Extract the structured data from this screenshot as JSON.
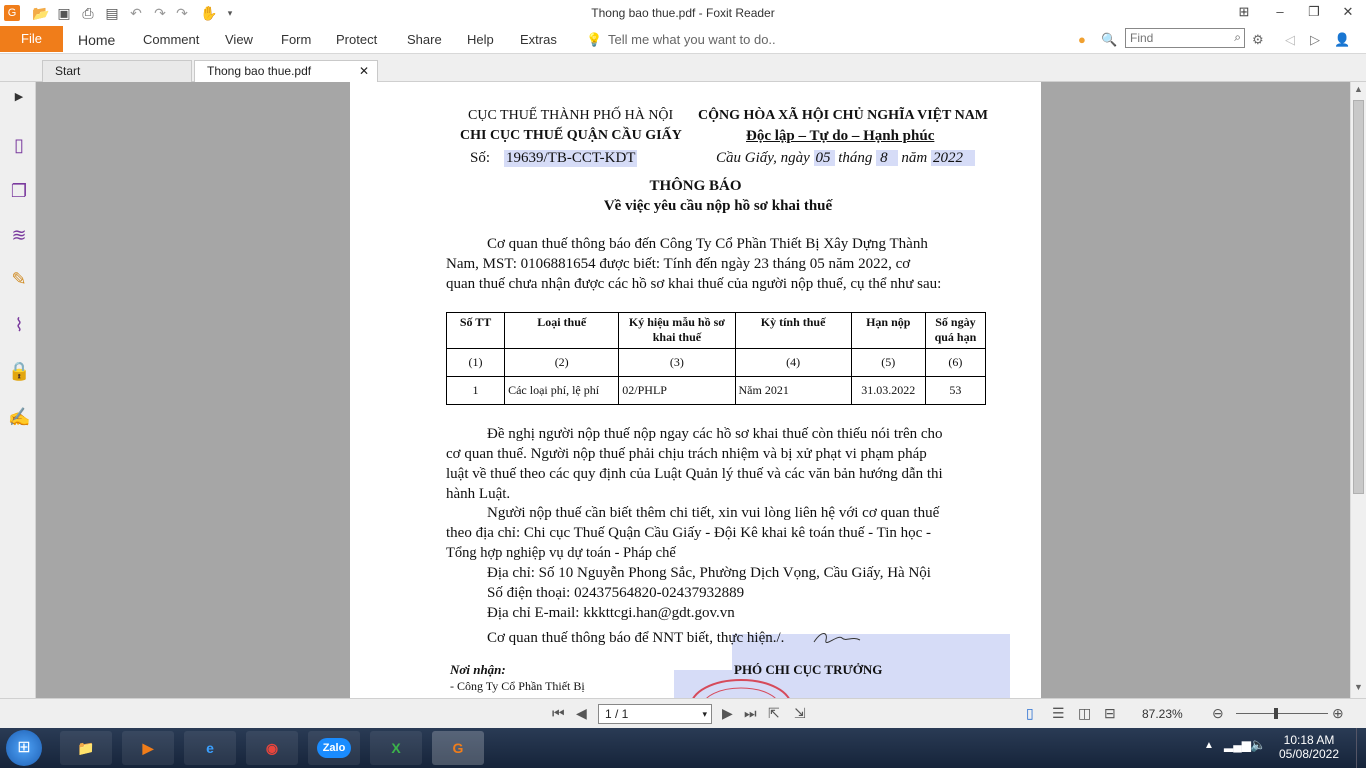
{
  "window": {
    "title": "Thong bao thue.pdf - Foxit Reader"
  },
  "ribbon": {
    "file": "File",
    "tabs": [
      "Home",
      "Comment",
      "View",
      "Form",
      "Protect",
      "Share",
      "Help",
      "Extras"
    ],
    "tell_me": "Tell me what you want to do..",
    "find_placeholder": "Find"
  },
  "tabs": {
    "start": "Start",
    "doc": "Thong bao thue.pdf"
  },
  "doc": {
    "agency1": "CỤC THUẾ THÀNH PHỐ HÀ NỘI",
    "agency2": "CHI CỤC THUẾ QUẬN CẦU GIẤY",
    "number_label": "Số:",
    "number_value": "19639/TB-CCT-KDT",
    "republic": "CỘNG HÒA XÃ HỘI CHỦ NGHĨA VIỆT NAM",
    "motto": "Độc lập – Tự do – Hạnh phúc",
    "date_prefix": "Cầu Giấy, ngày",
    "day": "05",
    "month_label": "tháng",
    "month": "8",
    "year_label": "năm",
    "year": "2022",
    "title": "THÔNG BÁO",
    "subtitle": "Về việc yêu cầu nộp hồ sơ khai thuế",
    "p1_l1": "Cơ quan thuế thông báo đến Công Ty Cổ Phần Thiết Bị Xây Dựng Thành",
    "p1_l2": "Nam, MST: 0106881654 được biết: Tính đến ngày 23 tháng 05 năm 2022, cơ",
    "p1_l3": "quan thuế chưa nhận được các hồ sơ khai thuế của người nộp thuế, cụ thể như sau:",
    "table": {
      "headers": [
        "Số TT",
        "Loại thuế",
        "Ký hiệu mẫu hồ sơ khai thuế",
        "Kỳ tính thuế",
        "Hạn nộp",
        "Số ngày quá hạn"
      ],
      "index_row": [
        "(1)",
        "(2)",
        "(3)",
        "(4)",
        "(5)",
        "(6)"
      ],
      "rows": [
        [
          "1",
          "Các loại phí, lệ phí",
          "02/PHLP",
          "Năm 2021",
          "31.03.2022",
          "53"
        ]
      ]
    },
    "p2_l1": "Đề nghị người nộp thuế nộp ngay các hồ sơ khai thuế còn thiếu nói trên cho",
    "p2_l2": "cơ quan thuế. Người nộp thuế phải chịu trách nhiệm và bị xử phạt vi phạm pháp",
    "p2_l3": "luật về thuế theo các quy định của Luật Quản lý thuế và các văn bản hướng dẫn thi",
    "p2_l4": "hành Luật.",
    "p3_l1": "Người nộp thuế cần biết thêm chi tiết, xin vui lòng liên hệ với cơ quan thuế",
    "p3_l2": "theo địa chỉ: Chi cục Thuế Quận Cầu Giấy -  Đội Kê khai kê toán thuế - Tin học -",
    "p3_l3": "Tổng hợp nghiệp vụ dự toán - Pháp chế",
    "address": "Địa chỉ: Số 10 Nguyễn Phong Sắc, Phường Dịch Vọng, Cầu Giấy, Hà Nội",
    "phone": "Số điện thoại: 02437564820-02437932889",
    "email": "Địa chỉ E-mail: kkkttcgi.han@gdt.gov.vn",
    "closing": "Cơ quan thuế thông báo để NNT biết, thực hiện./.",
    "recipients_label": "Nơi nhận:",
    "recipient1": "- Công Ty Cổ Phần Thiết Bị",
    "signer": "PHÓ CHI CỤC TRƯỞNG"
  },
  "status": {
    "page": "1 / 1",
    "zoom": "87.23%"
  },
  "taskbar": {
    "time": "10:18 AM",
    "date": "05/08/2022",
    "zalo": "Zalo"
  }
}
